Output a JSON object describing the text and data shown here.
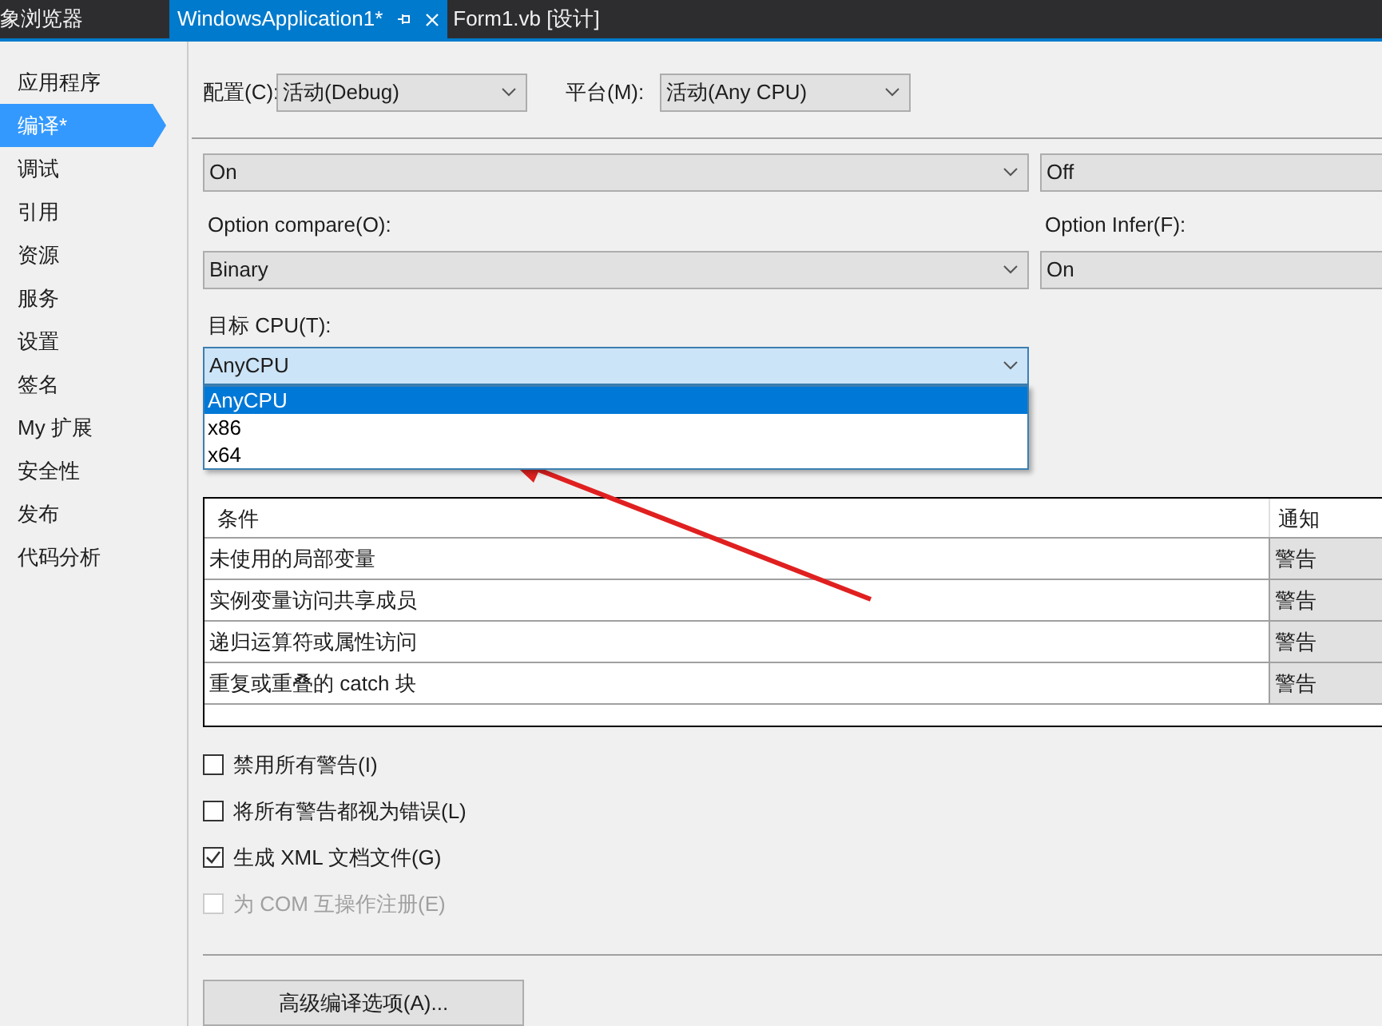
{
  "tabs": [
    {
      "label": "象浏览器",
      "selected": false
    },
    {
      "label": "WindowsApplication1*",
      "selected": true
    },
    {
      "label": "Form1.vb [设计]",
      "selected": false
    }
  ],
  "sidebar": {
    "items": [
      {
        "label": "应用程序",
        "selected": false
      },
      {
        "label": "编译*",
        "selected": true
      },
      {
        "label": "调试",
        "selected": false
      },
      {
        "label": "引用",
        "selected": false
      },
      {
        "label": "资源",
        "selected": false
      },
      {
        "label": "服务",
        "selected": false
      },
      {
        "label": "设置",
        "selected": false
      },
      {
        "label": "签名",
        "selected": false
      },
      {
        "label": "My 扩展",
        "selected": false
      },
      {
        "label": "安全性",
        "selected": false
      },
      {
        "label": "发布",
        "selected": false
      },
      {
        "label": "代码分析",
        "selected": false
      }
    ]
  },
  "configuration": {
    "label": "配置(C):",
    "value": "活动(Debug)"
  },
  "platform": {
    "label": "平台(M):",
    "value": "活动(Any CPU)"
  },
  "option_rows": [
    {
      "fields": [
        {
          "value": "On"
        },
        {
          "value": "Off"
        }
      ]
    },
    {
      "fields": [
        {
          "label": "Option compare(O):",
          "value": "Binary"
        },
        {
          "label": "Option Infer(F):",
          "value": "On"
        }
      ]
    }
  ],
  "target_cpu": {
    "label": "目标 CPU(T):",
    "value": "AnyCPU",
    "options": [
      {
        "label": "AnyCPU",
        "selected": true
      },
      {
        "label": "x86",
        "selected": false
      },
      {
        "label": "x64",
        "selected": false
      }
    ]
  },
  "warnings_table": {
    "columns": [
      "条件",
      "通知"
    ],
    "rows": [
      {
        "condition": "未使用的局部变量",
        "notification": "警告"
      },
      {
        "condition": "实例变量访问共享成员",
        "notification": "警告"
      },
      {
        "condition": "递归运算符或属性访问",
        "notification": "警告"
      },
      {
        "condition": "重复或重叠的 catch 块",
        "notification": "警告"
      }
    ]
  },
  "checkboxes": [
    {
      "label": "禁用所有警告(I)",
      "checked": false,
      "disabled": false
    },
    {
      "label": "将所有警告都视为错误(L)",
      "checked": false,
      "disabled": false
    },
    {
      "label": "生成 XML 文档文件(G)",
      "checked": true,
      "disabled": false
    },
    {
      "label": "为 COM 互操作注册(E)",
      "checked": false,
      "disabled": true
    }
  ],
  "advanced_button": "高级编译选项(A)..."
}
